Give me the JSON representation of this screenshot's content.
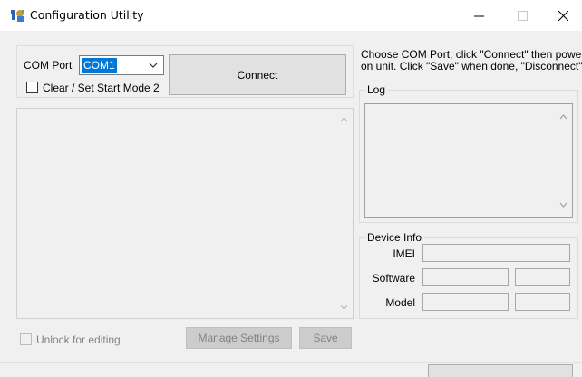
{
  "window": {
    "title": "Configuration Utility",
    "controls": {
      "minimize": "—",
      "maximize": "☐",
      "close": "✕"
    }
  },
  "connection": {
    "com_port_label": "COM Port",
    "com_port_value": "COM1",
    "start_mode_label": "Clear / Set Start Mode 2",
    "start_mode_checked": false,
    "connect_label": "Connect"
  },
  "instructions": {
    "line1": "Choose COM Port, click \"Connect\" then power",
    "line2": "on unit.  Click \"Save\" when done, \"Disconnect\""
  },
  "log": {
    "title": "Log"
  },
  "device_info": {
    "title": "Device Info",
    "imei_label": "IMEI",
    "software_label": "Software",
    "model_label": "Model"
  },
  "bottom": {
    "unlock_label": "Unlock for editing",
    "manage_settings_label": "Manage Settings",
    "save_label": "Save"
  },
  "colors": {
    "selection": "#0078d7",
    "disabled_text": "#838383",
    "button_face": "#e1e1e1"
  }
}
